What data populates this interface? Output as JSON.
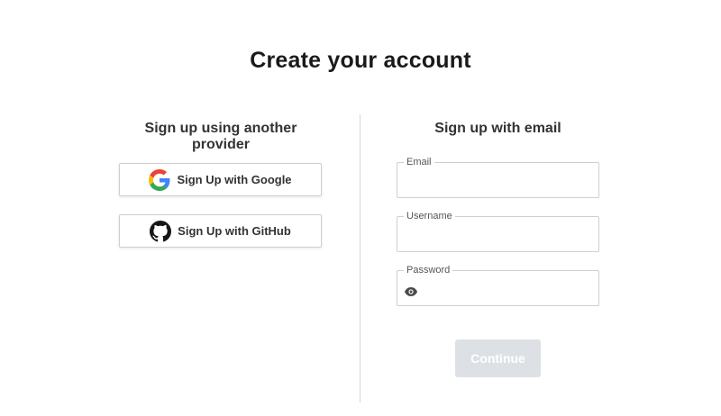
{
  "page": {
    "title": "Create your account"
  },
  "providers": {
    "heading": "Sign up using another provider",
    "google": {
      "label": "Sign Up with Google",
      "icon": "google-icon"
    },
    "github": {
      "label": "Sign Up with GitHub",
      "icon": "github-icon"
    }
  },
  "email_signup": {
    "heading": "Sign up with email",
    "email": {
      "label": "Email",
      "value": ""
    },
    "username": {
      "label": "Username",
      "value": ""
    },
    "password": {
      "label": "Password",
      "value": "",
      "toggle_icon": "eye-icon"
    },
    "continue_label": "Continue",
    "continue_enabled": false
  },
  "colors": {
    "continue_disabled_bg": "#dde1e6",
    "border": "#cfcfcf",
    "divider": "#d6d6d6"
  }
}
